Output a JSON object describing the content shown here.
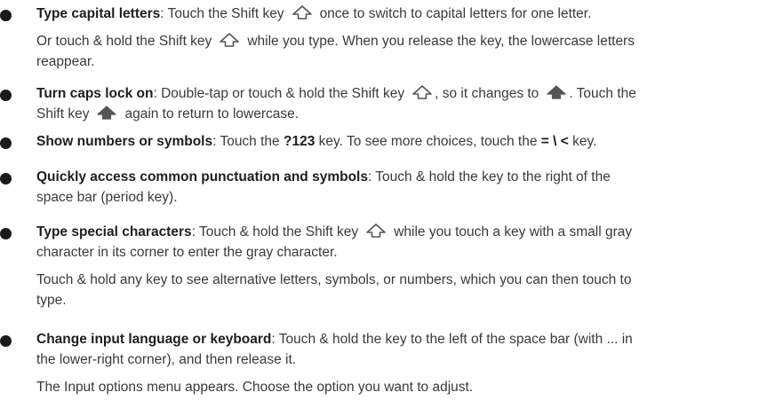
{
  "items": [
    {
      "title": "Type capital letters",
      "l1": ": Touch the Shift key",
      "l1b": "once to switch to capital letters for one letter.",
      "p2a": "Or touch & hold the Shift key",
      "p2b": "while you type. When you release the key, the lowercase letters",
      "p2c": "reappear."
    },
    {
      "title": "Turn caps lock on",
      "l1": ": Double-tap or touch & hold the Shift key",
      "l1b": ", so it changes to",
      "l1c": ". Touch the",
      "l2a": "Shift key",
      "l2b": "again to return to lowercase."
    },
    {
      "title": "Show numbers or symbols",
      "l1": ": Touch the",
      "key1": "?123",
      "l1b": "key. To see more choices, touch the",
      "key2": "= \\ <",
      "l1c": "key."
    },
    {
      "title": "Quickly access common punctuation and symbols",
      "l1": ": Touch & hold the key to the right of the",
      "l2": "space bar (period key)."
    },
    {
      "title": "Type special characters",
      "l1": ": Touch & hold the Shift key",
      "l1b": "while you touch a key with a small gray",
      "l2": "character in its corner to enter the gray character.",
      "p2a": "Touch & hold any key to see alternative letters, symbols, or numbers, which you can then touch to",
      "p2b": "type."
    },
    {
      "title": "Change input language or keyboard",
      "l1": ": Touch & hold the key to the left of the space bar (with ... in",
      "l2": "the lower-right corner), and then release it.",
      "p2": "The Input options menu appears. Choose the option you want to adjust."
    }
  ],
  "colors": {
    "text": "#3a3a3a",
    "bold": "#1e1e1e",
    "bullet": "#1a1a1a",
    "icon": "#555555"
  },
  "icons": [
    "shift-outline-icon",
    "shift-filled-icon"
  ]
}
